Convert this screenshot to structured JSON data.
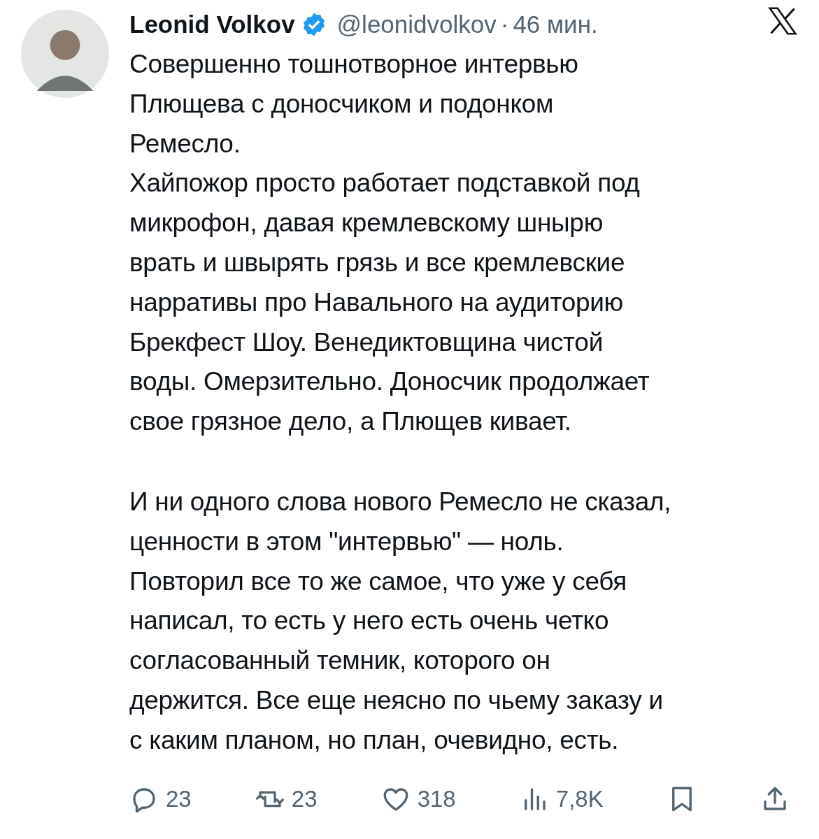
{
  "author": {
    "name": "Leonid Volkov",
    "verified": true,
    "handle": "@leonidvolkov",
    "separator": "·",
    "time": "46 мин."
  },
  "paragraphs": [
    {
      "lines": [
        "Совершенно тошнотворное интервью",
        "Плющева с доносчиком и подонком",
        "Ремесло.",
        "Хайпожор просто работает подставкой под",
        "микрофон, давая кремлевскому шнырю",
        "врать и швырять грязь и все кремлевские",
        "нарративы про Навального на аудиторию",
        "Брекфест Шоу. Венедиктовщина чистой",
        "воды. Омерзительно. Доносчик продолжает",
        "свое грязное дело, а Плющев кивает."
      ]
    },
    {
      "lines": [
        "И ни одного слова нового Ремесло не сказал,",
        "ценности в этом \"интервью\" — ноль.",
        "Повторил все то же самое, что уже у себя",
        "написал, то есть у него есть очень четко",
        "согласованный темник, которого он",
        "держится. Все еще неясно по чьему заказу и",
        "с каким планом, но план, очевидно, есть."
      ]
    }
  ],
  "actions": [
    {
      "kind": "reply",
      "count": "23"
    },
    {
      "kind": "repost",
      "count": "23"
    },
    {
      "kind": "like",
      "count": "318"
    },
    {
      "kind": "views",
      "count": "7,8K"
    },
    {
      "kind": "bookmark"
    },
    {
      "kind": "share"
    }
  ]
}
